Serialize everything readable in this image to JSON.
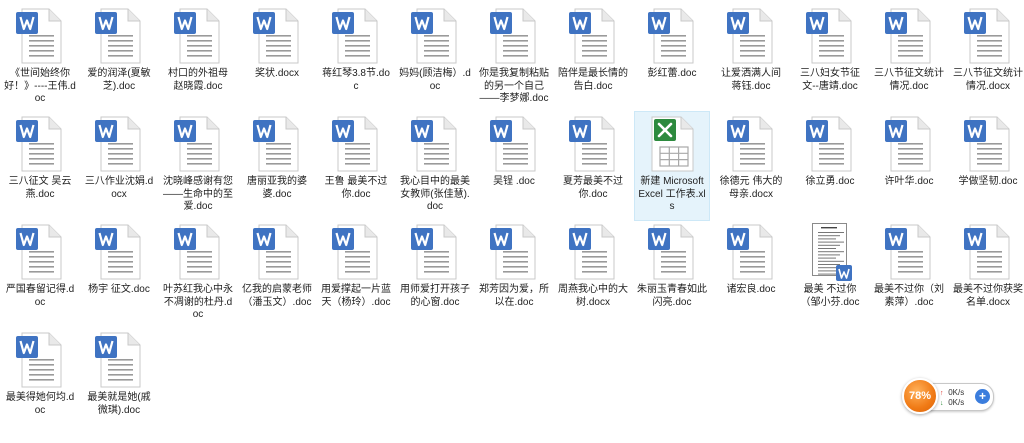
{
  "icons": {
    "word_icon": "wps-word-document-icon",
    "excel_icon": "wps-excel-spreadsheet-icon",
    "colors": {
      "word_blue": "#3f73c2",
      "excel_green": "#2d8a3e",
      "selection": "#e5f3fb",
      "speed_orange": "#f07a15"
    }
  },
  "files": [
    {
      "name": "《世间始终你好！》----王伟.doc",
      "type": "word"
    },
    {
      "name": "爱的润泽(夏敏芝).doc",
      "type": "word"
    },
    {
      "name": "村口的外祖母 赵晓霞.doc",
      "type": "word"
    },
    {
      "name": "奖状.docx",
      "type": "word"
    },
    {
      "name": "蒋红琴3.8节.doc",
      "type": "word"
    },
    {
      "name": "妈妈(顾洁梅）.doc",
      "type": "word"
    },
    {
      "name": "你是我复制粘贴的另一个自己——李梦娜.doc",
      "type": "word"
    },
    {
      "name": "陪伴是最长情的告白.doc",
      "type": "word"
    },
    {
      "name": "彭红蕾.doc",
      "type": "word"
    },
    {
      "name": "让爱洒满人间 蒋钰.doc",
      "type": "word"
    },
    {
      "name": "三八妇女节征文--唐靖.doc",
      "type": "word"
    },
    {
      "name": "三八节征文统计情况.doc",
      "type": "word"
    },
    {
      "name": "三八节征文统计情况.docx",
      "type": "word"
    },
    {
      "name": "三八征文 吴云燕.doc",
      "type": "word"
    },
    {
      "name": "三八作业沈娟.docx",
      "type": "word"
    },
    {
      "name": "沈晓峰感谢有您——生命中的至爱.doc",
      "type": "word"
    },
    {
      "name": "唐丽亚我的婆婆.doc",
      "type": "word"
    },
    {
      "name": "王鲁 最美不过你.doc",
      "type": "word"
    },
    {
      "name": "我心目中的最美女教师(张佳慧).doc",
      "type": "word"
    },
    {
      "name": "吴锃 .doc",
      "type": "word"
    },
    {
      "name": "夏芳最美不过你.doc",
      "type": "word"
    },
    {
      "name": "新建 Microsoft Excel 工作表.xls",
      "type": "excel",
      "selected": true
    },
    {
      "name": "徐德元 伟大的母亲.docx",
      "type": "word"
    },
    {
      "name": "徐立勇.doc",
      "type": "word"
    },
    {
      "name": "许叶华.doc",
      "type": "word"
    },
    {
      "name": "学做坚韧.doc",
      "type": "word"
    },
    {
      "name": "严国春留记得.doc",
      "type": "word"
    },
    {
      "name": "杨宇 征文.doc",
      "type": "word"
    },
    {
      "name": "叶苏红我心中永不凋谢的杜丹.doc",
      "type": "word"
    },
    {
      "name": "亿我的启蒙老师（潘玉文）.doc",
      "type": "word"
    },
    {
      "name": "用爱撑起一片蓝天（杨玲）.doc",
      "type": "word"
    },
    {
      "name": "用师爱打开孩子的心窗.doc",
      "type": "word"
    },
    {
      "name": "郑芳因为爱，所以在.doc",
      "type": "word"
    },
    {
      "name": "周燕我心中的大树.docx",
      "type": "word"
    },
    {
      "name": "朱丽玉青春如此闪亮.doc",
      "type": "word"
    },
    {
      "name": "诸宏良.doc",
      "type": "word"
    },
    {
      "name": "最美 不过你（邹小芬.doc",
      "type": "thumb"
    },
    {
      "name": "最美不过你（刘素萍）.doc",
      "type": "word"
    },
    {
      "name": "最美不过你获奖名单.docx",
      "type": "word"
    },
    {
      "name": "最美得她何均.doc",
      "type": "word"
    },
    {
      "name": "最美就是她(戚微琪).doc",
      "type": "word"
    }
  ],
  "speed_widget": {
    "percent": "78%",
    "upload": "0K/s",
    "download": "0K/s",
    "up_arrow": "↑",
    "down_arrow": "↓",
    "plus": "+"
  }
}
